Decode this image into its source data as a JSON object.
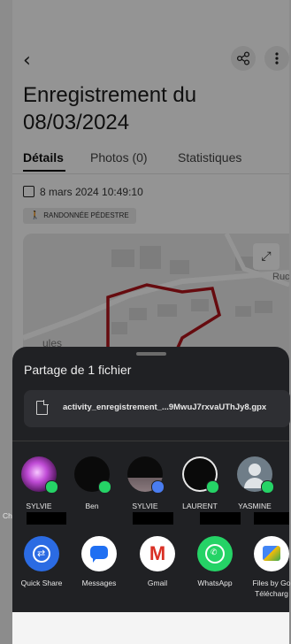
{
  "app": {
    "title": "Enregistrement du 08/03/2024",
    "tabs": [
      {
        "label": "Détails",
        "active": true
      },
      {
        "label": "Photos (0)",
        "active": false
      },
      {
        "label": "Statistiques",
        "active": false
      }
    ],
    "datetime": "8 mars 2024 10:49:10",
    "activity": "RANDONNÉE PÉDESTRE",
    "map_labels": {
      "street_left": "ules",
      "street_right": "Ruc"
    }
  },
  "share_sheet": {
    "title": "Partage de 1 fichier",
    "file_name": "activity_enregistrement_...9MwuJ7rxvaUThJy8.gpx",
    "contacts": [
      {
        "name": "SYLVIE",
        "app_badge": "whatsapp"
      },
      {
        "name": "Ben",
        "app_badge": "whatsapp"
      },
      {
        "name": "SYLVIE",
        "app_badge": "messages"
      },
      {
        "name": "LAURENT",
        "app_badge": "whatsapp"
      },
      {
        "name": "YASMINE",
        "app_badge": "whatsapp"
      }
    ],
    "contact_overflow_text": "Ch",
    "apps": [
      {
        "label": "Quick Share",
        "icon": "quick-share-icon",
        "color": "#2b6be3"
      },
      {
        "label": "Messages",
        "icon": "messages-icon",
        "color": "#1f6ff2"
      },
      {
        "label": "Gmail",
        "icon": "gmail-icon",
        "color": "#d93025",
        "glyph": "M"
      },
      {
        "label": "WhatsApp",
        "icon": "whatsapp-icon",
        "color": "#25d366"
      },
      {
        "label": "Files by Go",
        "label2": "Télécharg",
        "icon": "files-icon",
        "color": "#4285f4"
      }
    ]
  },
  "colors": {
    "sheet_bg": "#202124",
    "card_bg": "#2e2f33",
    "whatsapp_green": "#25d366"
  }
}
